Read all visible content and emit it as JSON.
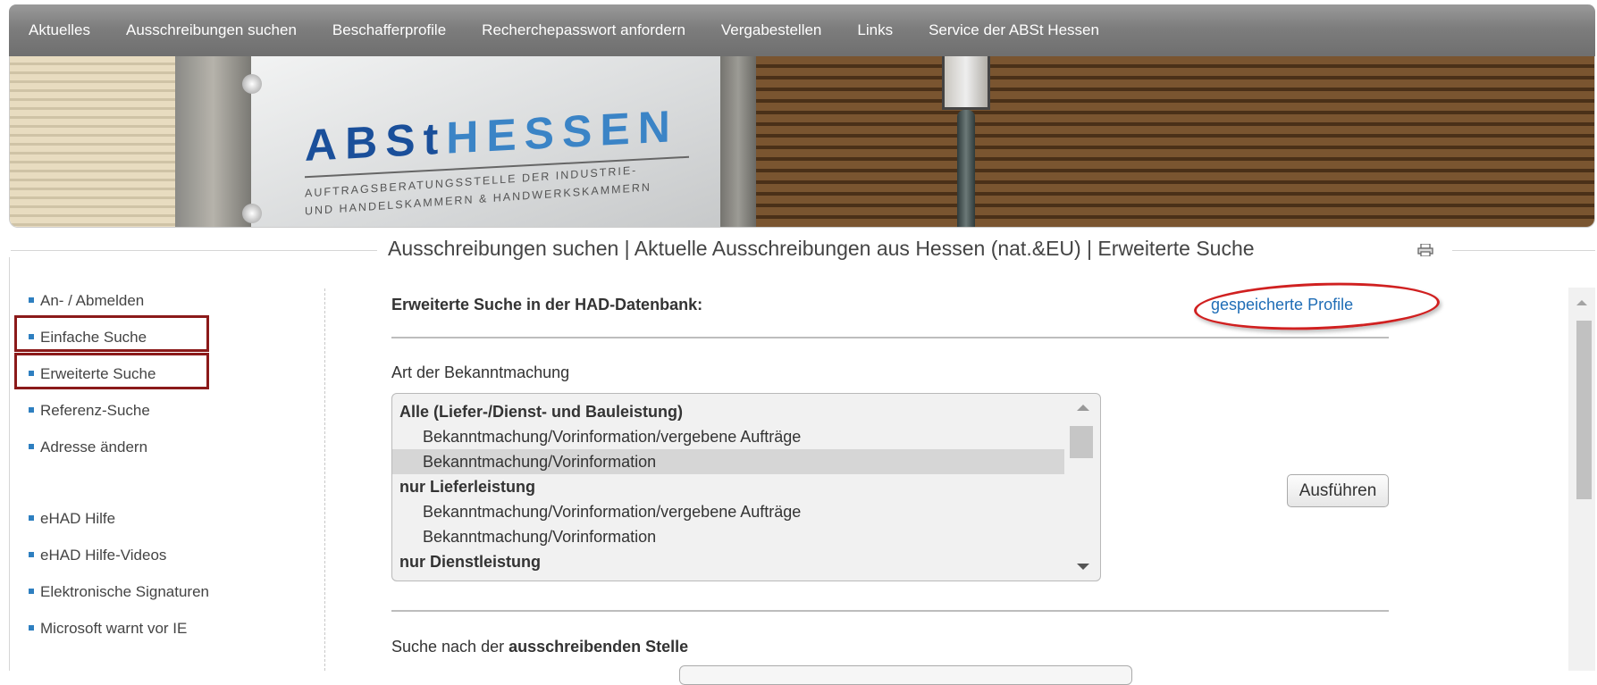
{
  "topnav": {
    "items": [
      "Aktuelles",
      "Ausschreibungen suchen",
      "Beschafferprofile",
      "Recherchepasswort anfordern",
      "Vergabestellen",
      "Links",
      "Service der ABSt Hessen"
    ]
  },
  "banner": {
    "logo_main_dark": "ABSt",
    "logo_main_light": "HESSEN",
    "logo_sub_1": "AUFTRAGSBERATUNGSSTELLE DER INDUSTRIE-",
    "logo_sub_2": "UND HANDELSKAMMERN & HANDWERKSKAMMERN"
  },
  "breadcrumb": "Ausschreibungen suchen | Aktuelle Ausschreibungen aus Hessen (nat.&EU) | Erweiterte Suche",
  "sidebar": {
    "items": [
      "An- / Abmelden",
      "Einfache Suche",
      "Erweiterte Suche",
      "Referenz-Suche",
      "Adresse ändern"
    ],
    "help_items": [
      "eHAD Hilfe",
      "eHAD Hilfe-Videos",
      "Elektronische Signaturen",
      "Microsoft warnt vor IE"
    ],
    "highlighted": [
      "Einfache Suche",
      "Erweiterte Suche"
    ],
    "highlight_color": "#8b1a1a"
  },
  "main": {
    "section_title": "Erweiterte Suche in der HAD-Datenbank:",
    "saved_profiles_link": "gespeicherte Profile",
    "annotation_color": "#d02020",
    "art_label": "Art der Bekanntmachung",
    "listbox_options": [
      {
        "label": "Alle (Liefer-/Dienst- und Bauleistung)",
        "kind": "group"
      },
      {
        "label": "Bekanntmachung/Vorinformation/vergebene Aufträge",
        "kind": "sub"
      },
      {
        "label": "Bekanntmachung/Vorinformation",
        "kind": "sub",
        "selected": true
      },
      {
        "label": "nur Lieferleistung",
        "kind": "group"
      },
      {
        "label": "Bekanntmachung/Vorinformation/vergebene Aufträge",
        "kind": "sub"
      },
      {
        "label": "Bekanntmachung/Vorinformation",
        "kind": "sub"
      },
      {
        "label": "nur Dienstleistung",
        "kind": "group"
      }
    ],
    "execute_button": "Ausführen",
    "search_label_prefix": "Suche nach der ",
    "search_label_bold": "ausschreibenden Stelle"
  },
  "icons": {
    "print": "printer-icon",
    "bullet": "square-bullet-icon"
  }
}
